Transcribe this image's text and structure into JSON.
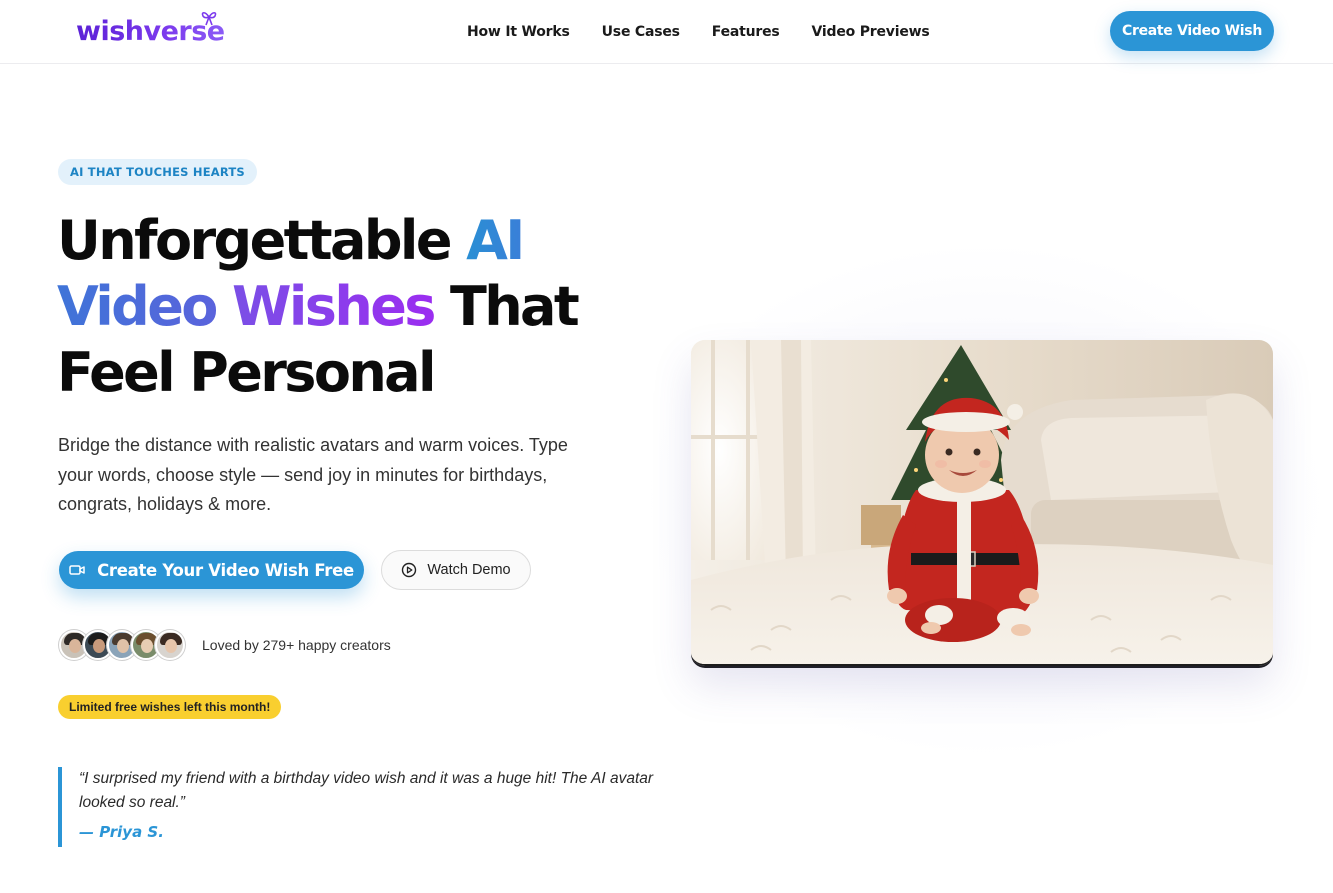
{
  "header": {
    "logo": "wishverse",
    "nav": [
      "How It Works",
      "Use Cases",
      "Features",
      "Video Previews"
    ],
    "cta": "Create Video Wish"
  },
  "hero": {
    "badge": "AI THAT TOUCHES HEARTS",
    "headline": {
      "part1": "Unforgettable ",
      "accent_ai": "AI",
      "accent_video": "Video",
      "accent_wishes": "Wishes",
      "part2": " That",
      "line3": "Feel Personal"
    },
    "subtext": "Bridge the distance with realistic avatars and warm voices. Type your words, choose style — send joy in minutes for birthdays, congrats, holidays & more.",
    "primary_cta": "Create Your Video Wish Free",
    "secondary_cta": "Watch Demo",
    "social_proof": "Loved by 279+ happy creators",
    "urgency": "Limited free wishes left this month!",
    "testimonial": {
      "quote": "“I surprised my friend with a birthday video wish and it was a huge hit! The AI avatar looked so real.”",
      "author": "— Priya S."
    }
  },
  "colors": {
    "accent": "#2b95d6",
    "brand_purple": "#6d28d9",
    "urgency_yellow": "#f9cf2f",
    "badge_bg": "#e3f1fb"
  },
  "icons": {
    "primary_cta": "video-camera-icon",
    "secondary_cta": "play-circle-icon",
    "logo": "gift-bow-icon"
  }
}
